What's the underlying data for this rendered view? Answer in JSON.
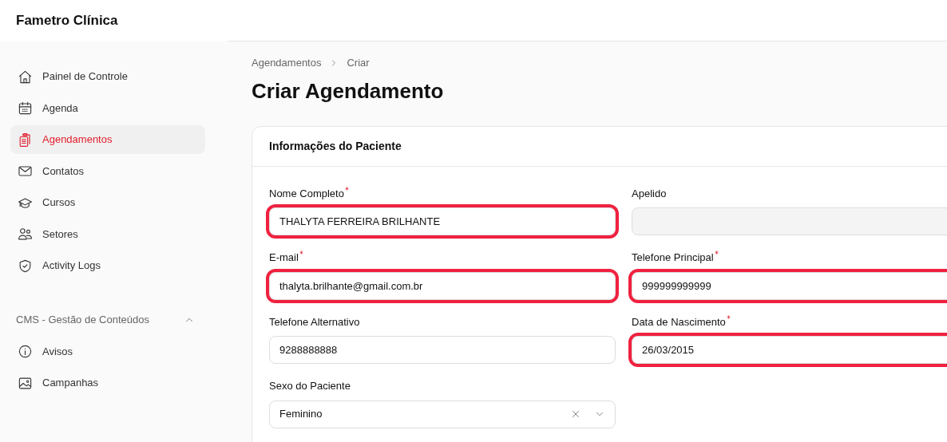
{
  "app": {
    "title": "Fametro Clínica"
  },
  "sidebar": {
    "items": [
      {
        "label": "Painel de Controle",
        "selected": false
      },
      {
        "label": "Agenda",
        "selected": false
      },
      {
        "label": "Agendamentos",
        "selected": true
      },
      {
        "label": "Contatos",
        "selected": false
      },
      {
        "label": "Cursos",
        "selected": false
      },
      {
        "label": "Setores",
        "selected": false
      },
      {
        "label": "Activity Logs",
        "selected": false
      }
    ],
    "section": {
      "title": "CMS - Gestão de Conteúdos",
      "expanded": true,
      "items": [
        {
          "label": "Avisos",
          "selected": false
        },
        {
          "label": "Campanhas",
          "selected": false
        }
      ]
    }
  },
  "breadcrumb": [
    "Agendamentos",
    "Criar"
  ],
  "page_title": "Criar Agendamento",
  "card": {
    "title": "Informações do Paciente",
    "fields": [
      {
        "kind": "text",
        "label": "Nome Completo",
        "required": true,
        "value": "THALYTA FERREIRA BRILHANTE",
        "highlighted": true
      },
      {
        "kind": "text",
        "label": "Apelido",
        "required": false,
        "highlighted": false
      },
      {
        "kind": "text",
        "label": "E-mail",
        "required": true,
        "value": "thalyta.brilhante@gmail.com.br",
        "highlighted": true
      },
      {
        "kind": "text",
        "label": "Telefone Principal",
        "required": true,
        "value": "999999999999",
        "highlighted": true
      },
      {
        "kind": "text",
        "label": "Telefone Alternativo",
        "required": false,
        "value": "9288888888",
        "highlighted": false
      },
      {
        "kind": "text",
        "label": "Data de Nascimento",
        "required": true,
        "value": "26/03/2015",
        "highlighted": true
      },
      {
        "kind": "select",
        "label": "Sexo do Paciente",
        "required": false,
        "value": "Feminino",
        "highlighted": false
      }
    ]
  }
}
